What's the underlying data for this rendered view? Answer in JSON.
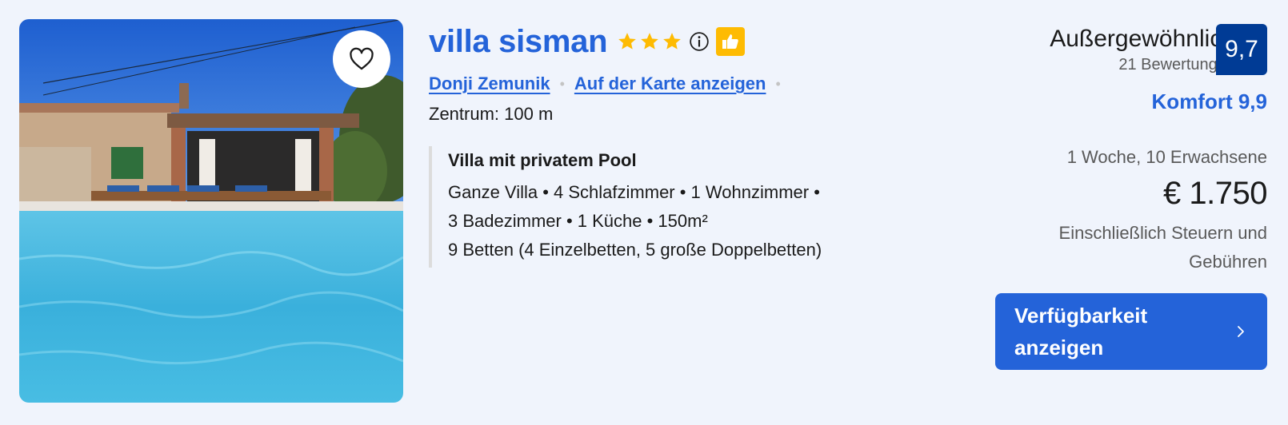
{
  "listing": {
    "name": "villa sisman",
    "star_count": 3,
    "location_link": "Donji Zemunik",
    "map_link": "Auf der Karte anzeigen",
    "distance": "Zentrum: 100 m"
  },
  "unit": {
    "title": "Villa mit privatem Pool",
    "line1": "Ganze Villa • 4 Schlafzimmer • 1 Wohnzimmer •",
    "line2": "3 Badezimmer • 1 Küche • 150m²",
    "line3": "9 Betten (4 Einzelbetten, 5 große Doppelbetten)"
  },
  "rating": {
    "label": "Außergewöhnlich",
    "reviews": "21 Bewertungen",
    "score": "9,7",
    "comfort": "Komfort 9,9"
  },
  "pricing": {
    "stay": "1 Woche, 10 Erwachsene",
    "price": "€ 1.750",
    "taxes": "Einschließlich Steuern und Gebühren"
  },
  "cta": {
    "label": "Verfügbarkeit anzeigen"
  },
  "colors": {
    "accent": "#2463d9",
    "score_bg": "#003b95",
    "star": "#febb02"
  },
  "icons": [
    "heart-icon",
    "star-icon",
    "info-icon",
    "thumbs-up-icon",
    "chevron-right-icon"
  ]
}
